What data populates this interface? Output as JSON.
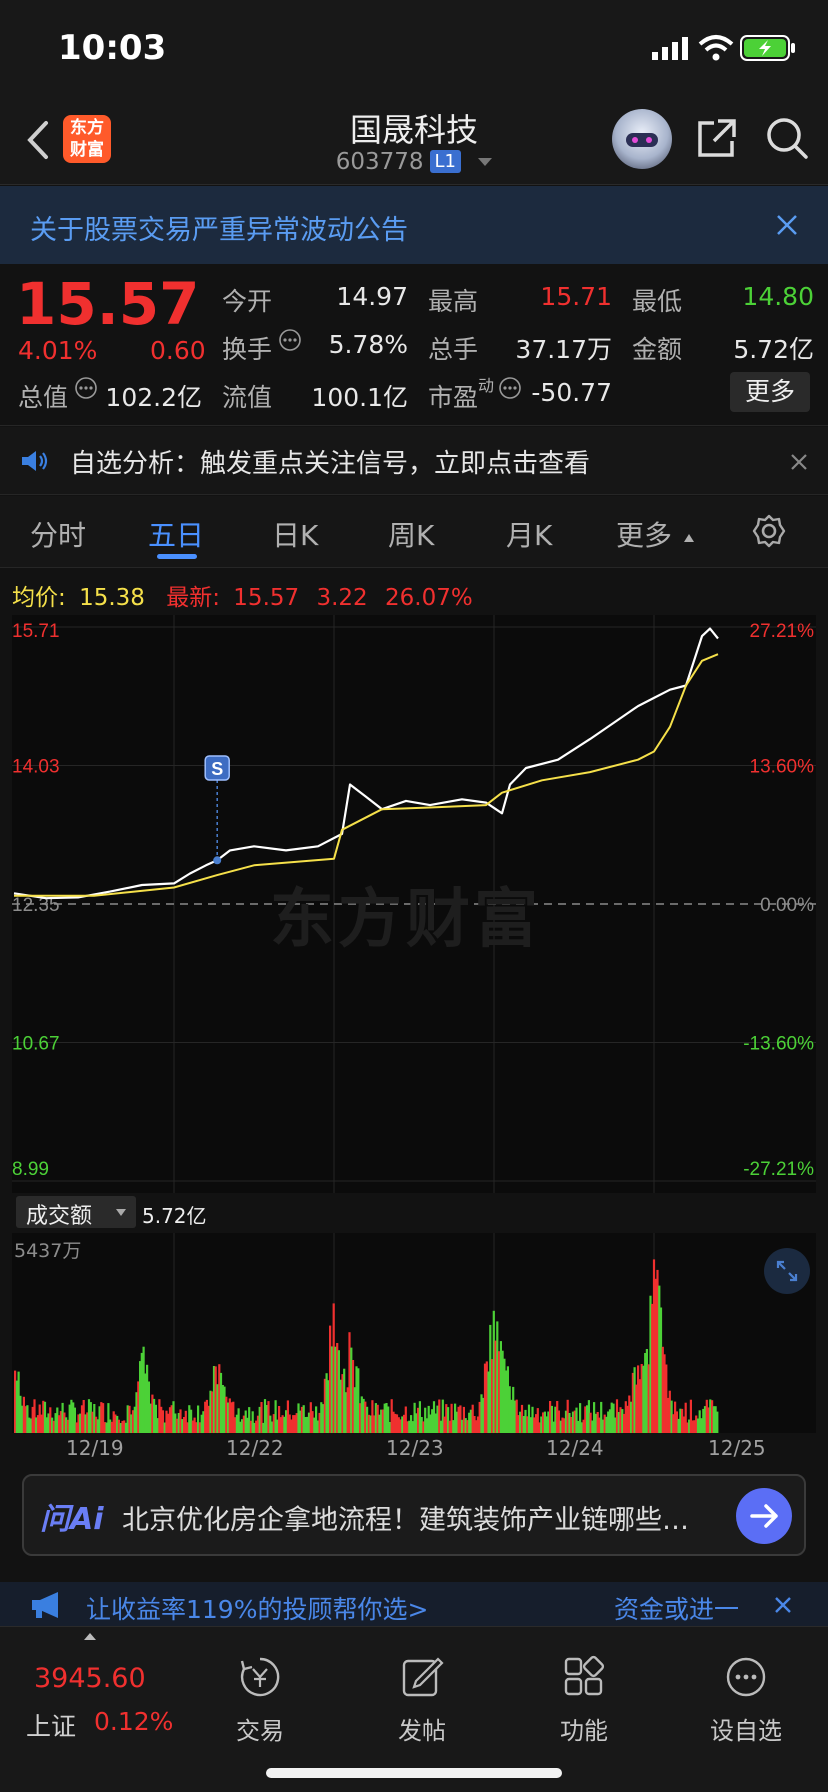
{
  "status_bar": {
    "time": "10:03"
  },
  "nav": {
    "brand_logo_text": "东方财富",
    "title": "国晟科技",
    "code": "603778",
    "level_badge": "L1"
  },
  "notice": {
    "text": "关于股票交易严重异常波动公告"
  },
  "quote": {
    "price": "15.57",
    "change_pct": "4.01%",
    "change": "0.60",
    "fields": {
      "open": {
        "label": "今开",
        "value": "14.97"
      },
      "high": {
        "label": "最高",
        "value": "15.71"
      },
      "low": {
        "label": "最低",
        "value": "14.80"
      },
      "turnover": {
        "label": "换手",
        "value": "5.78%"
      },
      "volume": {
        "label": "总手",
        "value": "37.17万"
      },
      "amount": {
        "label": "金额",
        "value": "5.72亿"
      },
      "mkt_cap": {
        "label": "总值",
        "value": "102.2亿"
      },
      "float_cap": {
        "label": "流值",
        "value": "100.1亿"
      },
      "pe": {
        "label": "市盈",
        "sup": "动",
        "value": "-50.77"
      }
    },
    "more_label": "更多"
  },
  "analysis": {
    "text": "自选分析：触发重点关注信号，立即点击查看"
  },
  "tabs": [
    "分时",
    "五日",
    "日K",
    "周K",
    "月K",
    "更多"
  ],
  "active_tab": "五日",
  "avg_line": {
    "avg_label": "均价:",
    "avg_value": "15.38",
    "latest_label": "最新:",
    "latest_value": "15.57",
    "change": "3.22",
    "change_pct": "26.07%"
  },
  "chart_data": {
    "type": "line",
    "title": "",
    "y_left_labels": [
      "15.71",
      "14.03",
      "12.35",
      "10.67",
      "8.99"
    ],
    "y_right_labels": [
      "27.21%",
      "13.60%",
      "0.00%",
      "-13.60%",
      "-27.21%"
    ],
    "ylim": [
      8.99,
      15.71
    ],
    "base": 12.35,
    "x_dates": [
      "12/19",
      "12/22",
      "12/23",
      "12/24",
      "12/25"
    ],
    "signal_marker": "S",
    "watermark": "东方财富",
    "series": [
      {
        "name": "最新",
        "color": "#ffffff",
        "points": [
          [
            0.0,
            12.48
          ],
          [
            0.2,
            12.42
          ],
          [
            0.4,
            12.43
          ],
          [
            0.6,
            12.5
          ],
          [
            0.8,
            12.58
          ],
          [
            1.0,
            12.6
          ],
          [
            1.1,
            12.72
          ],
          [
            1.2,
            12.82
          ],
          [
            1.27,
            12.88
          ],
          [
            1.35,
            13.0
          ],
          [
            1.5,
            13.05
          ],
          [
            1.7,
            13.0
          ],
          [
            1.9,
            13.05
          ],
          [
            2.05,
            13.2
          ],
          [
            2.1,
            13.8
          ],
          [
            2.2,
            13.65
          ],
          [
            2.3,
            13.5
          ],
          [
            2.45,
            13.6
          ],
          [
            2.6,
            13.55
          ],
          [
            2.8,
            13.62
          ],
          [
            2.95,
            13.58
          ],
          [
            3.05,
            13.45
          ],
          [
            3.1,
            13.8
          ],
          [
            3.2,
            14.0
          ],
          [
            3.4,
            14.1
          ],
          [
            3.6,
            14.35
          ],
          [
            3.75,
            14.55
          ],
          [
            3.9,
            14.75
          ],
          [
            4.0,
            14.85
          ],
          [
            4.1,
            14.95
          ],
          [
            4.2,
            15.0
          ],
          [
            4.25,
            15.3
          ],
          [
            4.3,
            15.6
          ],
          [
            4.35,
            15.69
          ],
          [
            4.4,
            15.57
          ]
        ]
      },
      {
        "name": "均价",
        "color": "#f5e04a",
        "points": [
          [
            0.0,
            12.45
          ],
          [
            0.5,
            12.45
          ],
          [
            1.0,
            12.55
          ],
          [
            1.27,
            12.7
          ],
          [
            1.5,
            12.82
          ],
          [
            2.0,
            12.9
          ],
          [
            2.05,
            13.25
          ],
          [
            2.3,
            13.5
          ],
          [
            2.6,
            13.52
          ],
          [
            2.95,
            13.55
          ],
          [
            3.05,
            13.7
          ],
          [
            3.3,
            13.85
          ],
          [
            3.6,
            13.95
          ],
          [
            3.9,
            14.1
          ],
          [
            4.0,
            14.2
          ],
          [
            4.1,
            14.5
          ],
          [
            4.2,
            15.0
          ],
          [
            4.3,
            15.3
          ],
          [
            4.4,
            15.38
          ]
        ]
      }
    ]
  },
  "volume": {
    "selector_label": "成交额",
    "amount": "5.72亿",
    "max_label": "5437万"
  },
  "ai": {
    "logo": "问Ai",
    "text": "北京优化房企拿地流程！建筑装饰产业链哪些…"
  },
  "promo": {
    "text": "让收益率119%的投顾帮你选>",
    "right_text": "资金或进一"
  },
  "bottom_bar": {
    "index_value": "3945.60",
    "index_name": "上证",
    "index_change": "0.12%",
    "items": [
      "交易",
      "发帖",
      "功能",
      "设自选"
    ]
  },
  "colors": {
    "up": "#f0302f",
    "down": "#4cd137",
    "accent": "#4a90ff",
    "avg_line": "#f5e04a",
    "notice_bg": "#1c2a3e"
  },
  "icons": [
    "back-icon",
    "brand-logo",
    "robot-avatar-icon",
    "share-icon",
    "search-icon",
    "close-icon",
    "speaker-icon",
    "gear-icon",
    "expand-icon",
    "arrow-right-icon",
    "trade-icon",
    "post-icon",
    "function-icon",
    "add-favorite-icon"
  ]
}
